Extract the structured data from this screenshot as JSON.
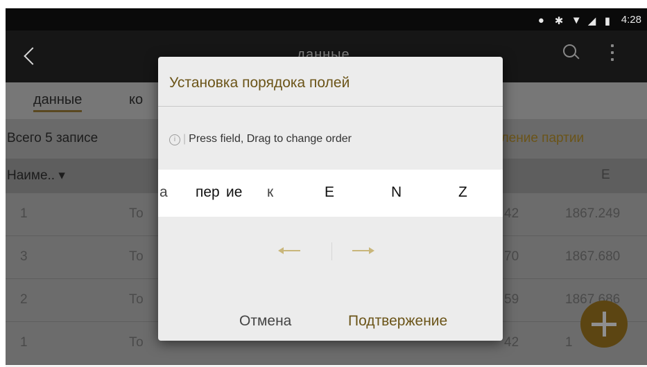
{
  "status_bar": {
    "time": "4:28"
  },
  "toolbar": {
    "title": "данные"
  },
  "tabs": [
    {
      "label": "данные"
    },
    {
      "label": "ко"
    }
  ],
  "info": {
    "records": "Всего 5 записе",
    "batch_delete": "аление партии"
  },
  "table": {
    "header_name": "Наиме..",
    "header_e": "E",
    "rows": [
      {
        "id": "1",
        "name": "То",
        "n": "42",
        "e": "1867.249"
      },
      {
        "id": "3",
        "name": "То",
        "n": "70",
        "e": "1867.680"
      },
      {
        "id": "2",
        "name": "То",
        "n": "59",
        "e": "1867.686"
      },
      {
        "id": "1",
        "name": "То",
        "n": "42",
        "e": "1"
      }
    ]
  },
  "dialog": {
    "title": "Установка порядока полей",
    "hint": "Press field, Drag to change order",
    "fields": [
      "а",
      "пер",
      "ие",
      "к",
      "E",
      "N",
      "Z"
    ],
    "cancel": "Отмена",
    "confirm": "Подтвержение"
  },
  "colors": {
    "accent": "#6b5418",
    "fab": "#5c4512"
  }
}
